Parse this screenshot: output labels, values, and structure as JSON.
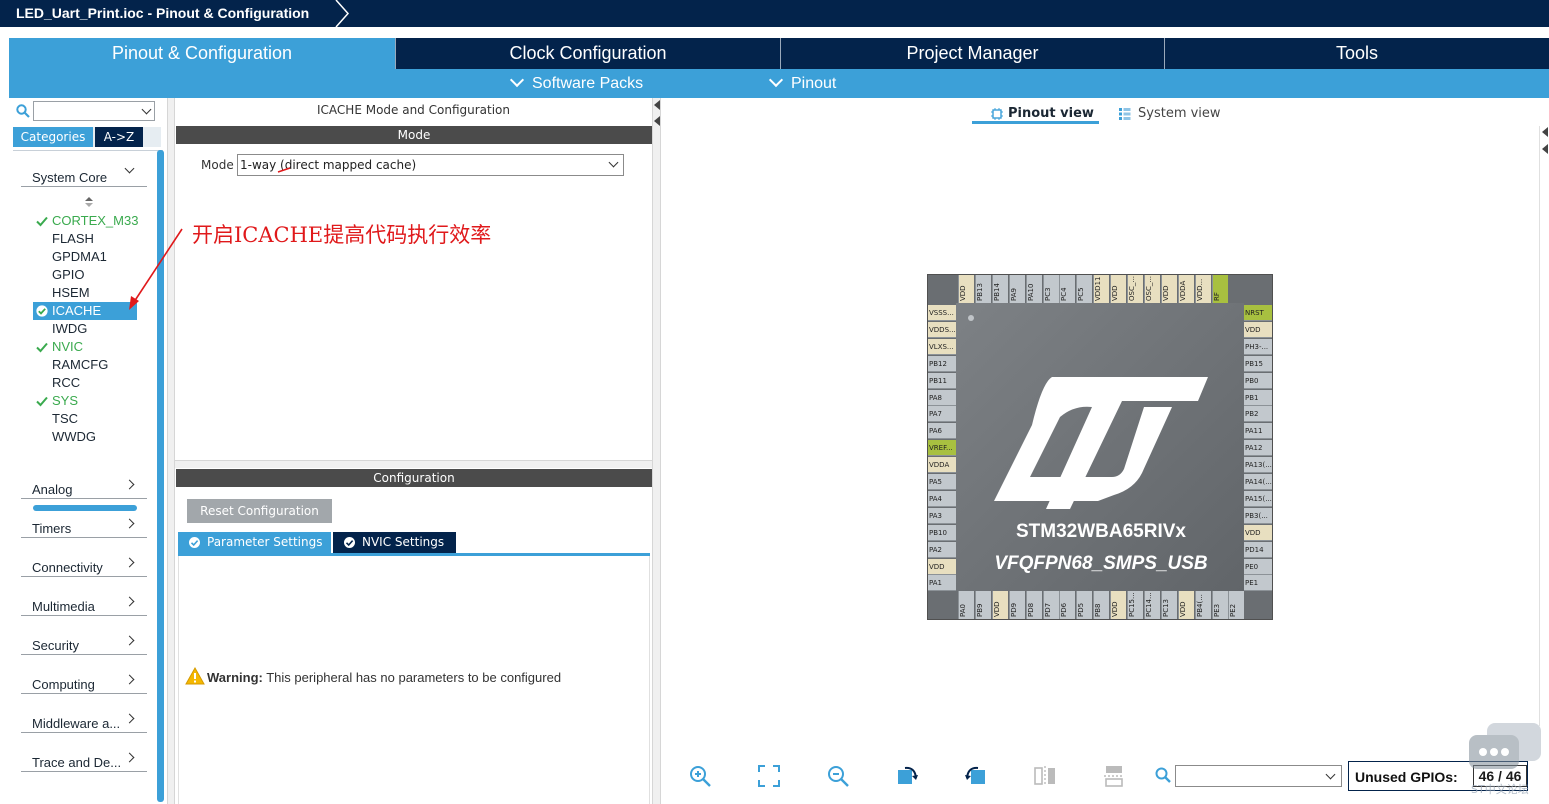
{
  "titlebar": {
    "breadcrumb": "LED_Uart_Print.ioc - Pinout & Configuration"
  },
  "main_tabs": [
    {
      "label": "Pinout & Configuration",
      "active": true
    },
    {
      "label": "Clock Configuration",
      "active": false
    },
    {
      "label": "Project Manager",
      "active": false
    },
    {
      "label": "Tools",
      "active": false
    }
  ],
  "sub_tabs": [
    {
      "label": "Software Packs"
    },
    {
      "label": "Pinout"
    }
  ],
  "sidebar": {
    "search_value": "",
    "tabs": {
      "categories": "Categories",
      "az": "A->Z"
    },
    "system_core": "System Core",
    "peripherals": [
      {
        "label": "CORTEX_M33",
        "state": "ok"
      },
      {
        "label": "FLASH",
        "state": "none"
      },
      {
        "label": "GPDMA1",
        "state": "none"
      },
      {
        "label": "GPIO",
        "state": "none"
      },
      {
        "label": "HSEM",
        "state": "none"
      },
      {
        "label": "ICACHE",
        "state": "selected"
      },
      {
        "label": "IWDG",
        "state": "none"
      },
      {
        "label": "NVIC",
        "state": "ok"
      },
      {
        "label": "RAMCFG",
        "state": "none"
      },
      {
        "label": "RCC",
        "state": "none"
      },
      {
        "label": "SYS",
        "state": "ok"
      },
      {
        "label": "TSC",
        "state": "none"
      },
      {
        "label": "WWDG",
        "state": "none"
      }
    ],
    "categories": [
      "Analog",
      "Timers",
      "Connectivity",
      "Multimedia",
      "Security",
      "Computing",
      "Middleware a...",
      "Trace and De..."
    ]
  },
  "mode_panel": {
    "title": "ICACHE Mode and Configuration",
    "mode_header": "Mode",
    "mode_label": "Mode",
    "mode_value": "1-way (direct mapped cache)",
    "config_header": "Configuration",
    "reset_button": "Reset Configuration",
    "settings_tabs": [
      "Parameter Settings",
      "NVIC Settings"
    ],
    "warning_bold": "Warning:",
    "warning_text": " This peripheral has no parameters to be configured"
  },
  "annotation": {
    "text": "开启ICACHE提高代码执行效率",
    "color": "#e0191b"
  },
  "view_tabs": {
    "pinout": "Pinout view",
    "system": "System view"
  },
  "chip": {
    "name": "STM32WBA65RIVx",
    "package": "VFQFPN68_SMPS_USB",
    "top_pins": [
      "",
      "VDD",
      "PB13",
      "PB14",
      "PA9",
      "PA10",
      "PC3",
      "PC4",
      "PC5",
      "VDD11",
      "VDD",
      "OSC_...",
      "OSC_...",
      "VDD",
      "VDDA",
      "VDD...",
      "RF"
    ],
    "bottom_pins": [
      "PA0",
      "PB9",
      "VDD",
      "PD9",
      "PD8",
      "PD7",
      "PD6",
      "PD5",
      "PB8",
      "VDD",
      "PC15...",
      "PC14...",
      "PC13",
      "VDD",
      "PB4(...",
      "PE3",
      "PE2"
    ],
    "left_pins": [
      "VSSS...",
      "VDDS...",
      "VLXS...",
      "PB12",
      "PB11",
      "PA8",
      "PA7",
      "PA6",
      "VREF...",
      "VDDA",
      "PA5",
      "PA4",
      "PA3",
      "PB10",
      "PA2",
      "VDD",
      "PA1"
    ],
    "right_pins": [
      "NRST",
      "VDD",
      "PH3-...",
      "PB15",
      "PB0",
      "PB1",
      "PB2",
      "PA11",
      "PA12",
      "PA13(...",
      "PA14(...",
      "PA15(...",
      "PB3(...",
      "VDD",
      "PD14",
      "PE0",
      "PE1"
    ]
  },
  "bottom_bar": {
    "gpio_search_value": "",
    "unused_label": "Unused GPIOs:",
    "unused_count": "46 / 46",
    "watermark": "ST中文论坛"
  },
  "colors": {
    "navy": "#03234b",
    "accent": "#3ca0d8",
    "ok_green": "#3aaa4e",
    "annotation_red": "#e0191b"
  }
}
